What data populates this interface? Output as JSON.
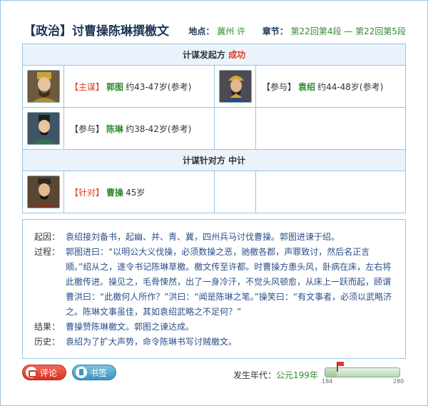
{
  "header": {
    "title": "【政治】讨曹操陈琳撰檄文",
    "location_label": "地点：",
    "location_value": "冀州 许",
    "chapter_label": "章节：",
    "chapter_value": "第22回第4段 — 第22回第5段"
  },
  "initiator": {
    "heading": "计谋发起方",
    "result": "成功",
    "people": [
      {
        "role_open": "【",
        "role": "主谋",
        "role_close": "】",
        "name": "郭图",
        "age": "约43-47岁(参考)",
        "role_color": "red"
      },
      {
        "role_open": "【",
        "role": "参与",
        "role_close": "】",
        "name": "袁绍",
        "age": "约44-48岁(参考)",
        "role_color": "plain"
      },
      {
        "role_open": "【",
        "role": "参与",
        "role_close": "】",
        "name": "陈琳",
        "age": "约38-42岁(参考)",
        "role_color": "plain"
      }
    ]
  },
  "target": {
    "heading": "计谋针对方",
    "result": "中计",
    "people": [
      {
        "role_open": "【",
        "role": "针对",
        "role_close": "】",
        "name": "曹操",
        "age": "45岁",
        "role_color": "red"
      }
    ]
  },
  "story": {
    "cause_label": "起因：",
    "cause": "袁绍接刘备书，起幽、并、青、冀，四州兵马讨伐曹操。郭图进谏于绍。",
    "process_label": "过程：",
    "process": "郭图进曰：“以明公大义伐操，必须数操之恶，驰檄各郡，声罪致讨，然后名正言顺。”绍从之，遂令书记陈琳草檄。檄文传至许都。时曹操方患头风，卧病在床，左右将此檄传进。操见之，毛骨悚然，出了一身冷汗，不觉头风顿愈，从床上一跃而起，顾谓曹洪曰：“此檄何人所作？”洪曰：“闻是陈琳之笔。”操笑曰：“有文事者，必须以武略济之。陈琳文事虽佳，其如袁绍武略之不足何？”",
    "result_label": "结果：",
    "result": "曹操赞陈琳檄文。郭图之谏达成。",
    "history_label": "历史：",
    "history": "袁绍为了扩大声势，命令陈琳书写讨贼檄文。"
  },
  "footer": {
    "comment_label": "评论",
    "bookmark_label": "书签",
    "year_label": "发生年代：",
    "year_value": "公元199年",
    "timeline_min": "184",
    "timeline_max": "280",
    "timeline_marker_fraction": 0.156
  },
  "icons": {
    "comment": "comment-icon",
    "bookmark": "bookmark-icon",
    "flag": "flag-icon"
  },
  "colors": {
    "accent_red": "#e03c1e",
    "name_green": "#2e8b2e",
    "story_blue": "#2a4f8a",
    "border_blue": "#9cc3e0",
    "title_navy": "#1f3558"
  }
}
